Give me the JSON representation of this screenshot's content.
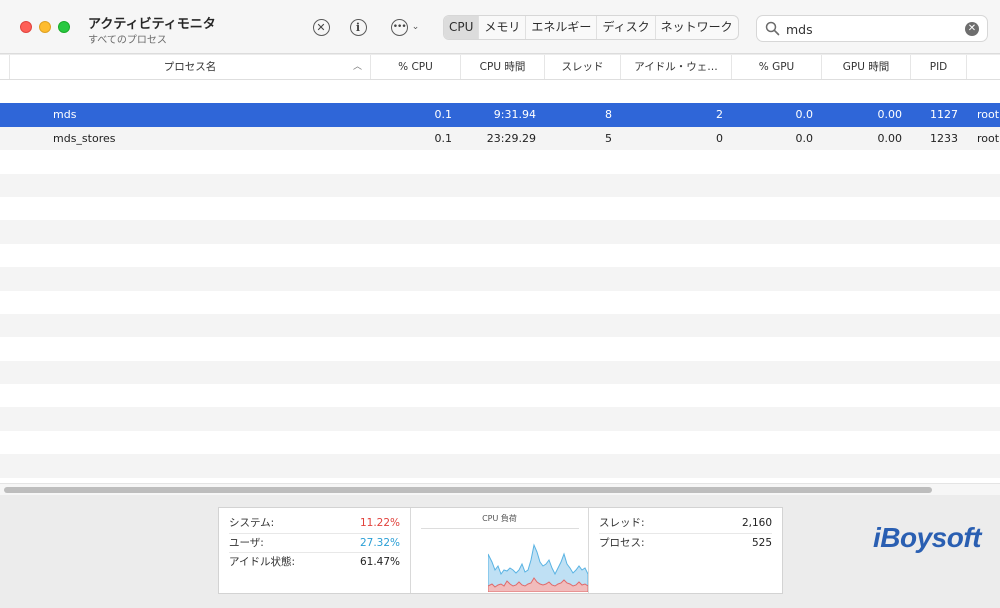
{
  "window": {
    "title": "アクティビティモニタ",
    "subtitle": "すべてのプロセス"
  },
  "toolbar": {
    "stop_icon": "x-circle-icon",
    "info_icon": "info-circle-icon",
    "more_icon": "ellipsis-circle-icon",
    "tabs": [
      {
        "label": "CPU",
        "active": true
      },
      {
        "label": "メモリ",
        "active": false
      },
      {
        "label": "エネルギー",
        "active": false
      },
      {
        "label": "ディスク",
        "active": false
      },
      {
        "label": "ネットワーク",
        "active": false
      }
    ],
    "search": {
      "value": "mds",
      "placeholder": ""
    }
  },
  "table": {
    "columns": [
      "プロセス名",
      "% CPU",
      "CPU 時間",
      "スレッド",
      "アイドル・ウェ…",
      "% GPU",
      "GPU 時間",
      "PID",
      ""
    ],
    "rows": [
      {
        "name": "mds",
        "cpu": "0.1",
        "cpu_time": "9:31.94",
        "threads": "8",
        "idle_wake": "2",
        "gpu": "0.0",
        "gpu_time": "0.00",
        "pid": "1127",
        "user": "root"
      },
      {
        "name": "mds_stores",
        "cpu": "0.1",
        "cpu_time": "23:29.29",
        "threads": "5",
        "idle_wake": "0",
        "gpu": "0.0",
        "gpu_time": "0.00",
        "pid": "1233",
        "user": "root"
      }
    ]
  },
  "stats": {
    "system_label": "システム:",
    "system_value": "11.22%",
    "user_label": "ユーザ:",
    "user_value": "27.32%",
    "idle_label": "アイドル状態:",
    "idle_value": "61.47%",
    "chart_title": "CPU 負荷",
    "threads_label": "スレッド:",
    "threads_value": "2,160",
    "processes_label": "プロセス:",
    "processes_value": "525"
  },
  "colors": {
    "selection": "#2f66d8",
    "system": "#e2423b",
    "user": "#2a9fd6",
    "brand": "#2a5fb2"
  },
  "watermark": "iBoysoft"
}
